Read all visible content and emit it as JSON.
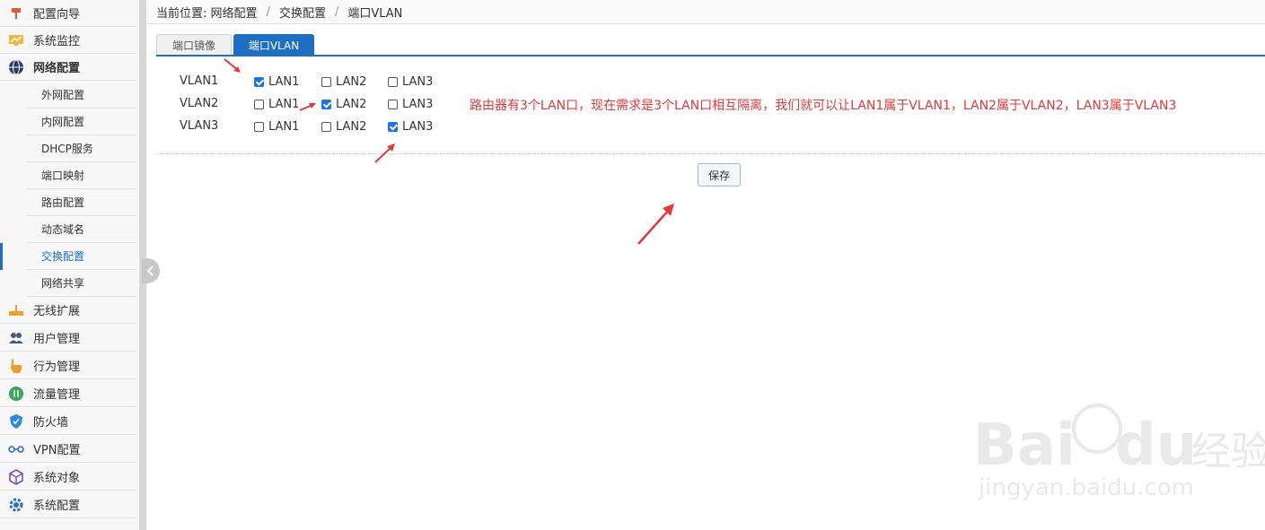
{
  "sidebar": {
    "items": [
      {
        "label": "配置向导",
        "icon": "pin-icon"
      },
      {
        "label": "系统监控",
        "icon": "monitor-icon"
      },
      {
        "label": "网络配置",
        "icon": "globe-icon"
      },
      {
        "label": "无线扩展",
        "icon": "router-icon"
      },
      {
        "label": "用户管理",
        "icon": "users-icon"
      },
      {
        "label": "行为管理",
        "icon": "hand-icon"
      },
      {
        "label": "流量管理",
        "icon": "traffic-icon"
      },
      {
        "label": "防火墙",
        "icon": "shield-icon"
      },
      {
        "label": "VPN配置",
        "icon": "vpn-icon"
      },
      {
        "label": "系统对象",
        "icon": "cube-icon"
      },
      {
        "label": "系统配置",
        "icon": "gear-icon"
      }
    ],
    "subitems": [
      "外网配置",
      "内网配置",
      "DHCP服务",
      "端口映射",
      "路由配置",
      "动态域名",
      "交换配置",
      "网络共享"
    ],
    "active_subitem": "交换配置"
  },
  "breadcrumb": {
    "prefix": "当前位置:",
    "path": [
      "网络配置",
      "交换配置",
      "端口VLAN"
    ]
  },
  "tabs": [
    {
      "label": "端口镜像",
      "active": false
    },
    {
      "label": "端口VLAN",
      "active": true
    }
  ],
  "vlan_table": {
    "rows": [
      {
        "name": "VLAN1",
        "ports": [
          {
            "label": "LAN1",
            "checked": true
          },
          {
            "label": "LAN2",
            "checked": false
          },
          {
            "label": "LAN3",
            "checked": false
          }
        ]
      },
      {
        "name": "VLAN2",
        "ports": [
          {
            "label": "LAN1",
            "checked": false
          },
          {
            "label": "LAN2",
            "checked": true
          },
          {
            "label": "LAN3",
            "checked": false
          }
        ]
      },
      {
        "name": "VLAN3",
        "ports": [
          {
            "label": "LAN1",
            "checked": false
          },
          {
            "label": "LAN2",
            "checked": false
          },
          {
            "label": "LAN3",
            "checked": true
          }
        ]
      }
    ]
  },
  "annotation": "路由器有3个LAN口，现在需求是3个LAN口相互隔离，我们就可以让LAN1属于VLAN1，LAN2属于VLAN2，LAN3属于VLAN3",
  "save_label": "保存",
  "watermark": {
    "brand": "Baidu经验",
    "url": "jingyan.baidu.com"
  },
  "colors": {
    "accent": "#1e6fc4",
    "annotation": "#e03a3a",
    "checkbox": "#1a73e8"
  }
}
